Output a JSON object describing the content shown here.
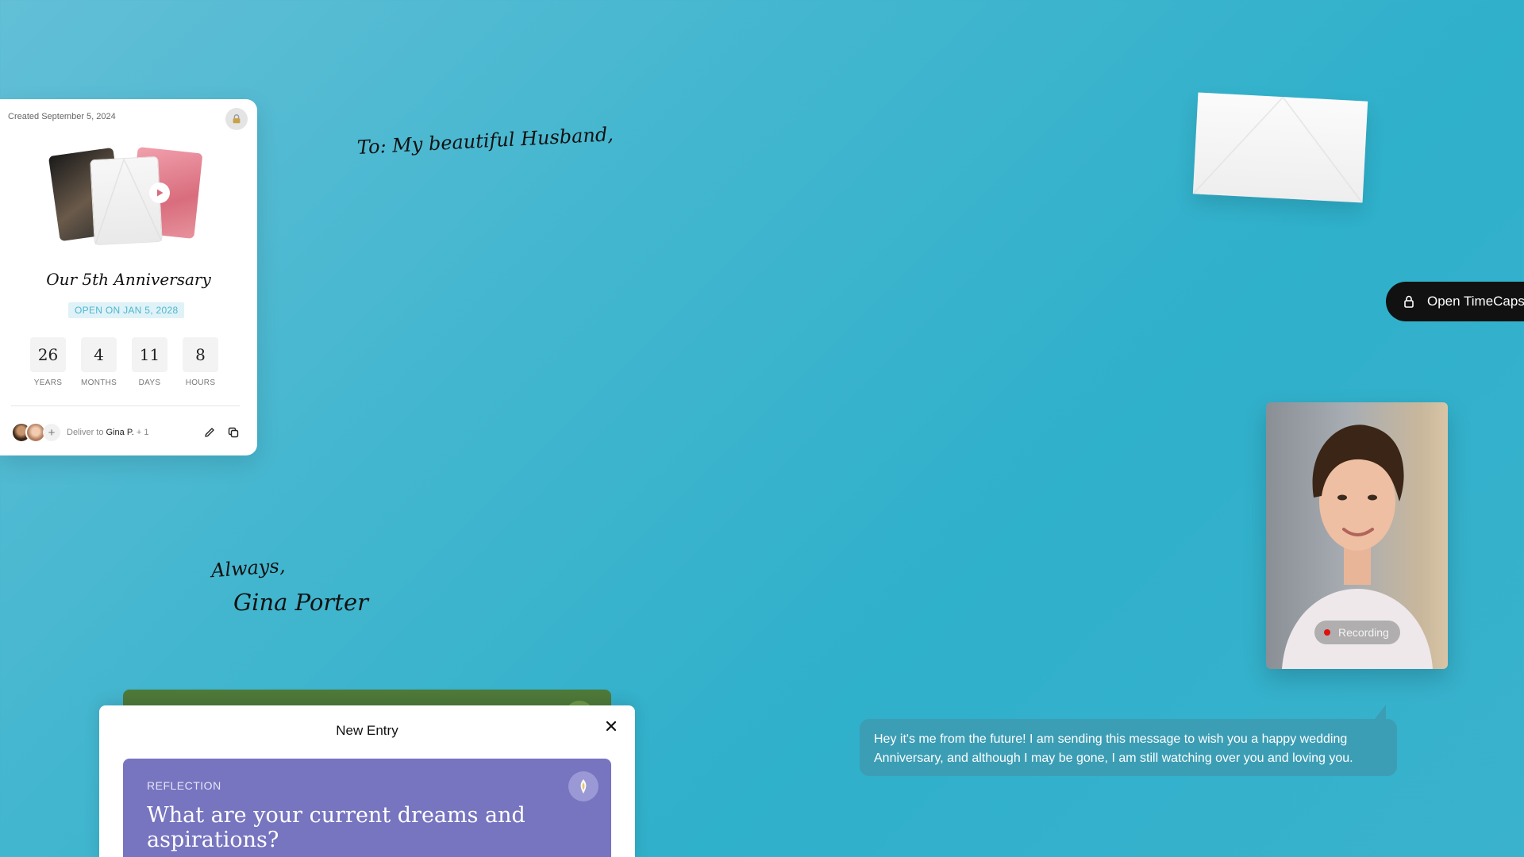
{
  "capsule": {
    "created": "Created September 5, 2024",
    "title": "Our 5th Anniversary",
    "open_date": "OPEN ON JAN 5, 2028",
    "countdown": [
      {
        "value": "26",
        "label": "YEARS"
      },
      {
        "value": "4",
        "label": "MONTHS"
      },
      {
        "value": "11",
        "label": "DAYS"
      },
      {
        "value": "8",
        "label": "HOURS"
      }
    ],
    "deliver_prefix": "Deliver to",
    "deliver_name": "Gina P.",
    "deliver_extra": "+ 1",
    "add_symbol": "+"
  },
  "letter": {
    "to_line": "To: My beautiful Husband,",
    "closing": "Always,",
    "signature": "Gina Porter"
  },
  "open_button": {
    "label": "Open TimeCapsule"
  },
  "video": {
    "recording_label": "Recording"
  },
  "message": {
    "text": "Hey it's me from the future! I am sending this message to wish you a happy wedding Anniversary, and although I may be gone, I am still watching over you and loving you."
  },
  "dialog": {
    "title": "New Entry",
    "prompt_category": "REFLECTION",
    "prompt_question": "What are your current dreams and aspirations?"
  },
  "colors": {
    "background": "#43b6cf",
    "accent": "#4fb6cf",
    "prompt_card": "#7774c0",
    "button": "#111111",
    "recording_dot": "#e01010"
  }
}
